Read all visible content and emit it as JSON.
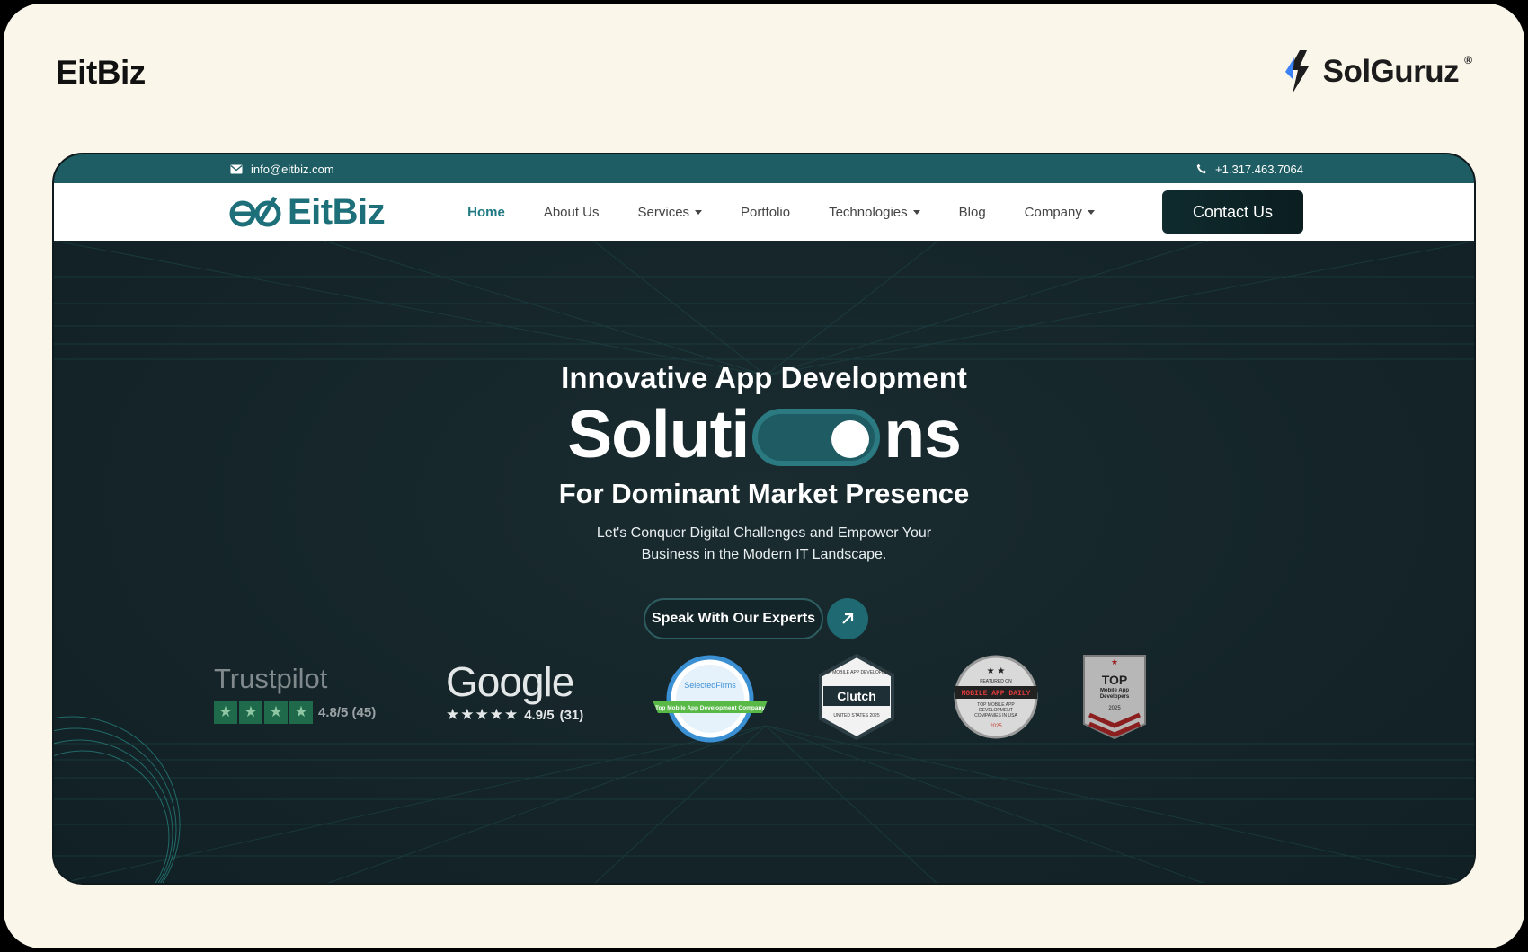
{
  "page": {
    "brand_left": "EitBiz",
    "brand_right": "SolGuruz",
    "brand_right_mark": "®"
  },
  "site": {
    "topbar": {
      "email": "info@eitbiz.com",
      "phone": "+1.317.463.7064"
    },
    "logo": "EitBiz",
    "nav": [
      {
        "label": "Home",
        "active": true,
        "dropdown": false
      },
      {
        "label": "About Us",
        "active": false,
        "dropdown": false
      },
      {
        "label": "Services",
        "active": false,
        "dropdown": true
      },
      {
        "label": "Portfolio",
        "active": false,
        "dropdown": false
      },
      {
        "label": "Technologies",
        "active": false,
        "dropdown": true
      },
      {
        "label": "Blog",
        "active": false,
        "dropdown": false
      },
      {
        "label": "Company",
        "active": false,
        "dropdown": true
      }
    ],
    "contact_label": "Contact Us"
  },
  "hero": {
    "title_line1": "Innovative App Development",
    "title_big_start": "Soluti",
    "title_big_end": "ns",
    "title_line3": "For Dominant Market Presence",
    "subtitle_line1": "Let's Conquer Digital Challenges and Empower Your",
    "subtitle_line2": "Business in the Modern IT Landscape.",
    "cta_label": "Speak With Our Experts"
  },
  "badges": {
    "trustpilot": {
      "name": "Trustpilot",
      "rating": "4.8/5 (45)"
    },
    "google": {
      "name": "Google",
      "rating": "4.9/5",
      "count": "(31)"
    },
    "selectedfirms": {
      "name": "SelectedFirms",
      "ribbon": "Top Mobile App Development Company"
    },
    "clutch": {
      "top": "TOP MOBILE APP DEVELOPERS",
      "name": "Clutch",
      "bottom": "UNITED STATES 2025"
    },
    "mobileappdaily": {
      "band": "MOBILE APP DAILY",
      "top": "FEATURED ON",
      "caption": "TOP MOBILE APP DEVELOPMENT COMPANIES IN USA",
      "year": "2025"
    },
    "topdevelopers": {
      "title": "TOP",
      "caption": "Mobile App Developers",
      "year": "2025"
    }
  },
  "colors": {
    "accent": "#1f7a84",
    "topbar": "#1f5d64",
    "hero_bg": "#16272b",
    "frame_bg": "#fbf6ea"
  }
}
